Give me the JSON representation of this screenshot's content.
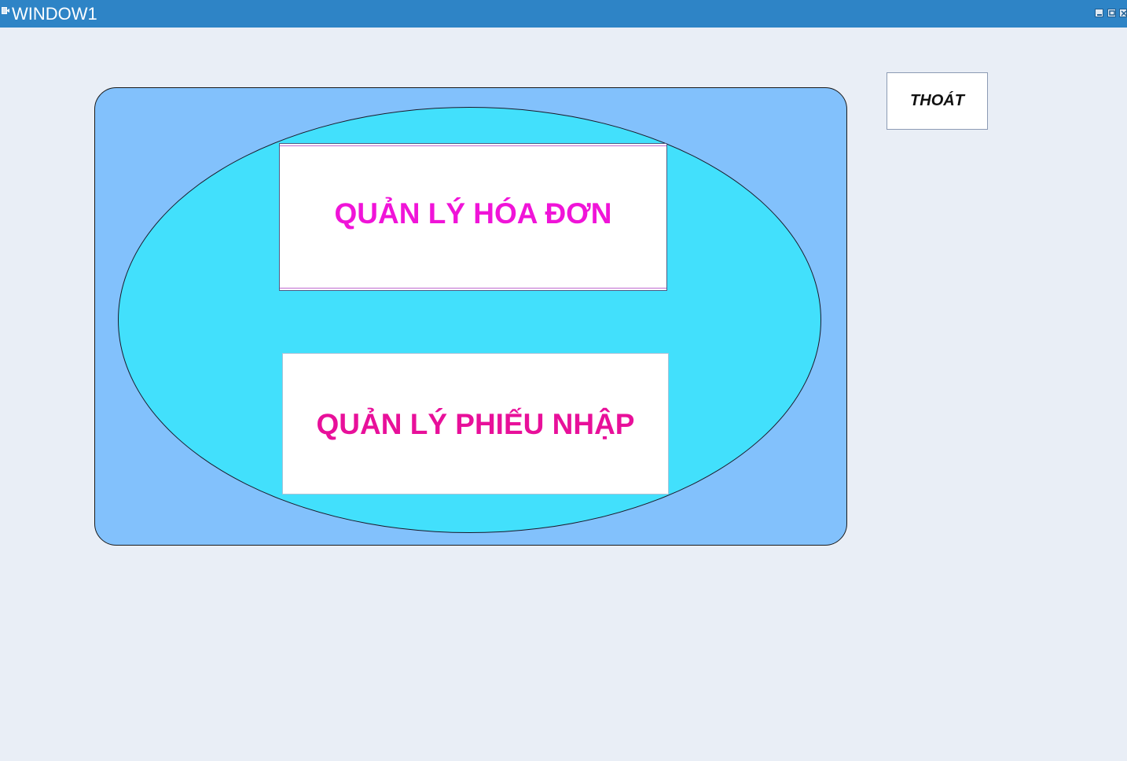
{
  "window": {
    "title": "WINDOW1",
    "icon": "app-icon",
    "controls": [
      "minimize-icon",
      "maximize-icon",
      "close-icon"
    ]
  },
  "main": {
    "invoices_label": "QUẢN LÝ HÓA ĐƠN",
    "receipts_label": "QUẢN LÝ PHIẾU NHẬP"
  },
  "exit_label": "THOÁT",
  "colors": {
    "titlebar": "#2e84c6",
    "background": "#e9eef6",
    "panel": "#82c1fc",
    "ellipse": "#42e0fc",
    "invoices_text": "#f014d8",
    "receipts_text": "#e8109a"
  }
}
